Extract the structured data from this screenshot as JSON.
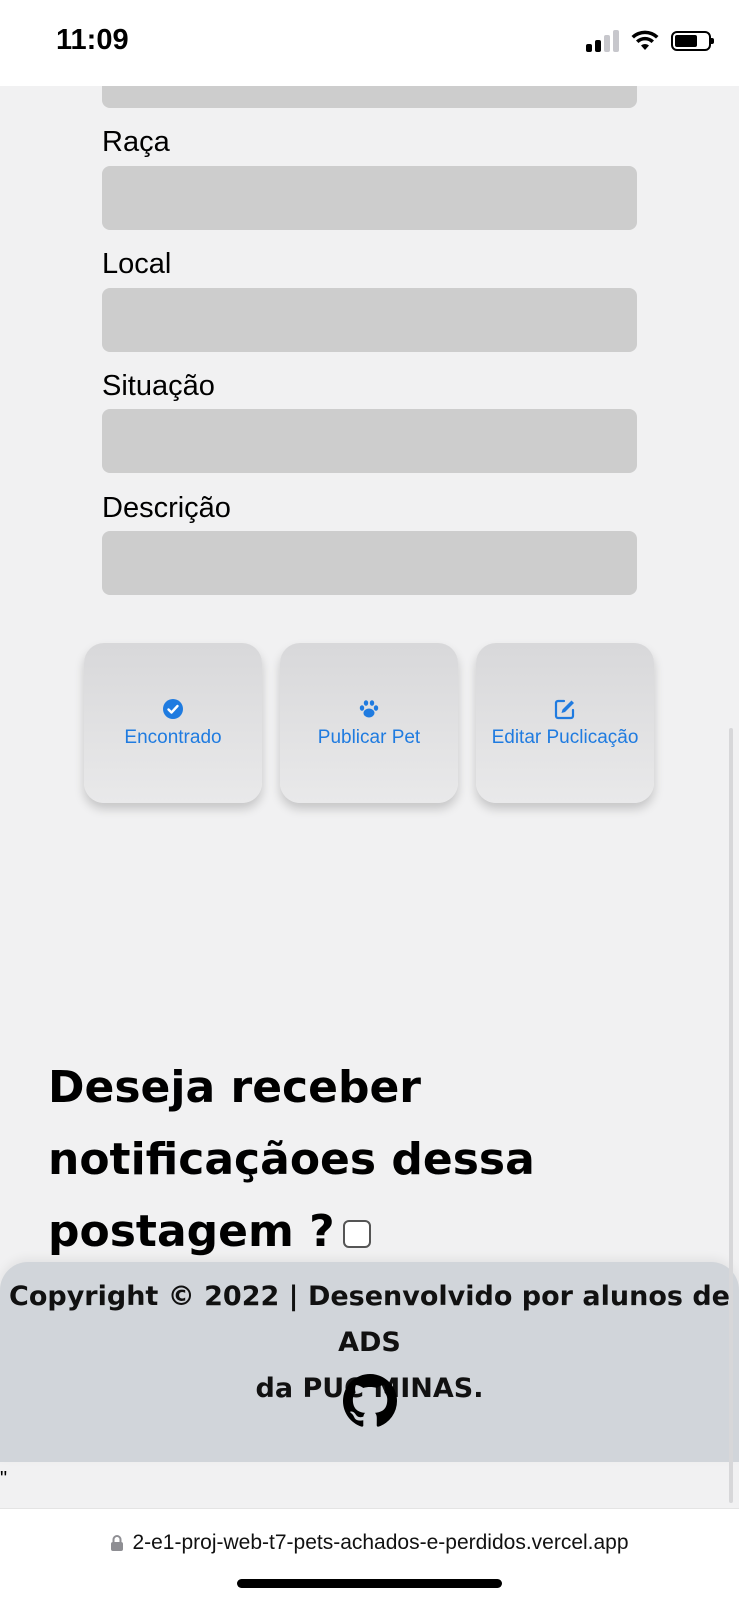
{
  "status_bar": {
    "time": "11:09"
  },
  "form": {
    "fields": [
      {
        "label": "Raça"
      },
      {
        "label": "Local"
      },
      {
        "label": "Situação"
      },
      {
        "label": "Descrição"
      }
    ]
  },
  "actions": [
    {
      "label": "Encontrado",
      "icon": "check-circle-icon"
    },
    {
      "label": "Publicar Pet",
      "icon": "paw-icon"
    },
    {
      "label": "Editar Puclicação",
      "icon": "edit-icon"
    }
  ],
  "notification": {
    "question": "Deseja receber notificaçãoes dessa postagem ?",
    "checked": false
  },
  "footer": {
    "copyright": "Copyright © 2022 | Desenvolvido por alunos de ADS\nda PUC MINAS.",
    "icon": "github-icon"
  },
  "stray_text": "\"",
  "browser": {
    "url": "2-e1-proj-web-t7-pets-achados-e-perdidos.vercel.app"
  },
  "colors": {
    "accent": "#1f7be0",
    "input_bg": "#cdcdcd",
    "footer_bg": "#d1d5da",
    "page_bg": "#f1f1f2"
  }
}
